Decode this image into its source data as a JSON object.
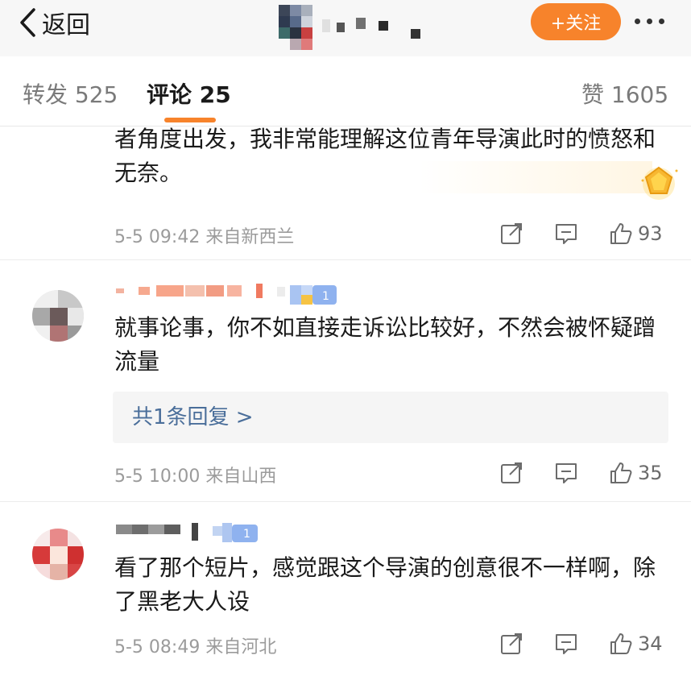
{
  "nav": {
    "back_label": "返回",
    "follow_label": "+关注"
  },
  "tabs": {
    "repost_label": "转发",
    "repost_count": "525",
    "comment_label": "评论",
    "comment_count": "25",
    "like_label": "赞",
    "like_count": "1605"
  },
  "colors": {
    "accent": "#f7832b",
    "link": "#4a6e9a",
    "muted": "#9b9b9b"
  },
  "comments": [
    {
      "text": "者角度出发，我非常能理解这位青年导演此时的愤怒和无奈。",
      "time": "5-5 09:42",
      "location": "来自新西兰",
      "likes": "93"
    },
    {
      "text": "就事论事，你不如直接走诉讼比较好，不然会被怀疑蹭流量",
      "reply_summary": "共1条回复 >",
      "time": "5-5 10:00",
      "location": "来自山西",
      "likes": "35"
    },
    {
      "text": "看了那个短片，感觉跟这个导演的创意很不一样啊，除了黑老大人设",
      "time": "5-5 08:49",
      "location": "来自河北",
      "likes": "34"
    }
  ],
  "icons": {
    "back": "chevron-left-icon",
    "more": "more-dots-icon",
    "repost": "share-square-icon",
    "comment": "comment-bubble-icon",
    "like": "thumbs-up-icon",
    "badge": "gold-badge-icon"
  }
}
